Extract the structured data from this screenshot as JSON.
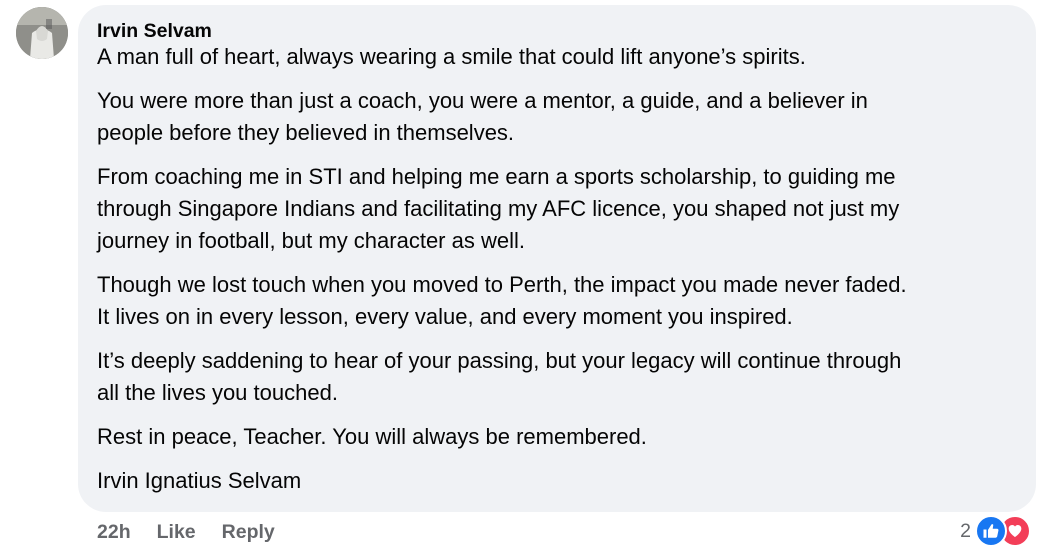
{
  "comment": {
    "author": "Irvin Selvam",
    "paragraphs": [
      "A man full of heart, always wearing a smile that could lift anyone’s spirits.",
      "You were more than just a coach, you were a mentor, a guide, and a believer in\npeople before they believed in themselves.",
      "From coaching me in STI and helping me earn a sports scholarship, to guiding me\nthrough Singapore Indians and facilitating my AFC licence, you shaped not just my\njourney in football, but my character as well.",
      "Though we lost touch when you moved to Perth, the impact you made never faded.\nIt lives on in every lesson, every value, and every moment you inspired.",
      "It’s deeply saddening to hear of your passing, but your legacy will continue through\nall the lives you touched.",
      "Rest in peace, Teacher. You will always be remembered.",
      "Irvin Ignatius Selvam"
    ]
  },
  "actions": {
    "time": "22h",
    "like_label": "Like",
    "reply_label": "Reply"
  },
  "reactions": {
    "count": "2",
    "icons": [
      "like-icon",
      "love-icon"
    ]
  },
  "colors": {
    "bubble_bg": "#f0f2f5",
    "meta_text": "#65676b",
    "like_blue": "#1877f2",
    "love_red": "#f33e58"
  }
}
